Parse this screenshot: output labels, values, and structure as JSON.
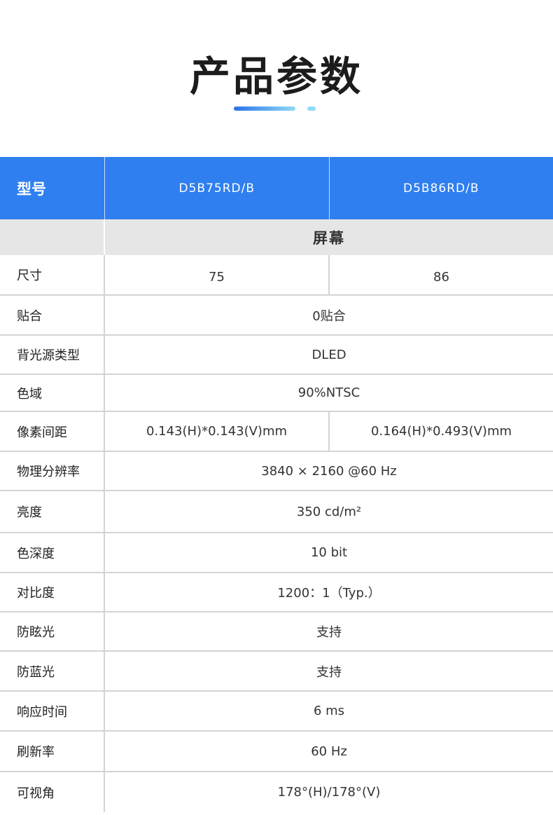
{
  "title": "产品参数",
  "table": {
    "header": {
      "label": "型号",
      "models": [
        "D5B75RD/B",
        "D5B86RD/B"
      ]
    },
    "section": "屏幕",
    "rows": [
      {
        "label": "尺寸",
        "values": [
          "75",
          "86"
        ]
      },
      {
        "label": "贴合",
        "value": "0贴合"
      },
      {
        "label": "背光源类型",
        "value": "DLED"
      },
      {
        "label": "色域",
        "value": "90%NTSC"
      },
      {
        "label": "像素间距",
        "values": [
          "0.143(H)*0.143(V)mm",
          "0.164(H)*0.493(V)mm"
        ]
      },
      {
        "label": "物理分辨率",
        "value": "3840 × 2160 @60 Hz"
      },
      {
        "label": "亮度",
        "value": "350 cd/m²"
      },
      {
        "label": "色深度",
        "value": "10 bit"
      },
      {
        "label": "对比度",
        "value": "1200：1（Typ.）"
      },
      {
        "label": "防眩光",
        "value": "支持"
      },
      {
        "label": "防蓝光",
        "value": "支持"
      },
      {
        "label": "响应时间",
        "value": "6 ms"
      },
      {
        "label": "刷新率",
        "value": "60 Hz"
      },
      {
        "label": "可视角",
        "value": "178°(H)/178°(V)"
      }
    ]
  },
  "colors": {
    "accent": "#2f7ff0",
    "gradient_end": "#8fdaf6",
    "section_bg": "#e6e6e6",
    "border": "#d4d4d4"
  }
}
